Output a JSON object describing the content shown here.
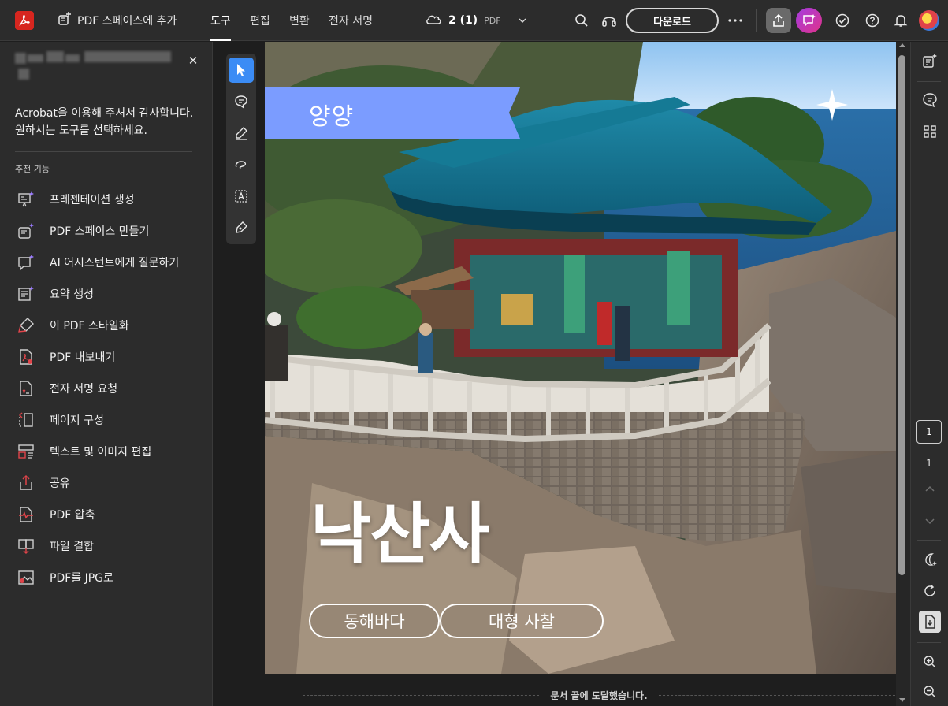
{
  "topbar": {
    "add_space_label": "PDF 스페이스에 추가",
    "tabs": [
      "도구",
      "편집",
      "변환",
      "전자 서명"
    ],
    "active_tab": "도구",
    "file_pages": "2 (1)",
    "file_ext": "PDF",
    "download_label": "다운로드"
  },
  "left_panel": {
    "welcome_line1": "Acrobat을 이용해 주셔서 감사합니다.",
    "welcome_line2": "원하시는 도구를 선택하세요.",
    "section_label": "추천 기능",
    "items": [
      {
        "label": "프레젠테이션 생성",
        "icon": "presentation-sparkle-icon"
      },
      {
        "label": "PDF 스페이스 만들기",
        "icon": "pdf-space-icon"
      },
      {
        "label": "AI 어시스턴트에게 질문하기",
        "icon": "ai-chat-icon"
      },
      {
        "label": "요약 생성",
        "icon": "summary-sparkle-icon"
      },
      {
        "label": "이 PDF 스타일화",
        "icon": "brush-icon"
      },
      {
        "label": "PDF 내보내기",
        "icon": "export-pdf-icon"
      },
      {
        "label": "전자 서명 요청",
        "icon": "request-signature-icon"
      },
      {
        "label": "페이지 구성",
        "icon": "organize-pages-icon"
      },
      {
        "label": "텍스트 및 이미지 편집",
        "icon": "edit-text-image-icon"
      },
      {
        "label": "공유",
        "icon": "share-icon"
      },
      {
        "label": "PDF 압축",
        "icon": "compress-pdf-icon"
      },
      {
        "label": "파일 결합",
        "icon": "combine-files-icon"
      },
      {
        "label": "PDF를 JPG로",
        "icon": "pdf-to-jpg-icon"
      }
    ]
  },
  "document": {
    "banner_text": "양양",
    "title": "낙산사",
    "tags": [
      "동해바다",
      "대형 사찰"
    ],
    "end_message": "문서 끝에 도달했습니다."
  },
  "right_rail": {
    "current_page": "1",
    "total_pages": "1"
  },
  "colors": {
    "accent": "#3b8cf5",
    "acrobat_red": "#d7261f",
    "banner": "#7b9cff",
    "background": "#1e1e1e",
    "panel": "#2c2c2c"
  }
}
